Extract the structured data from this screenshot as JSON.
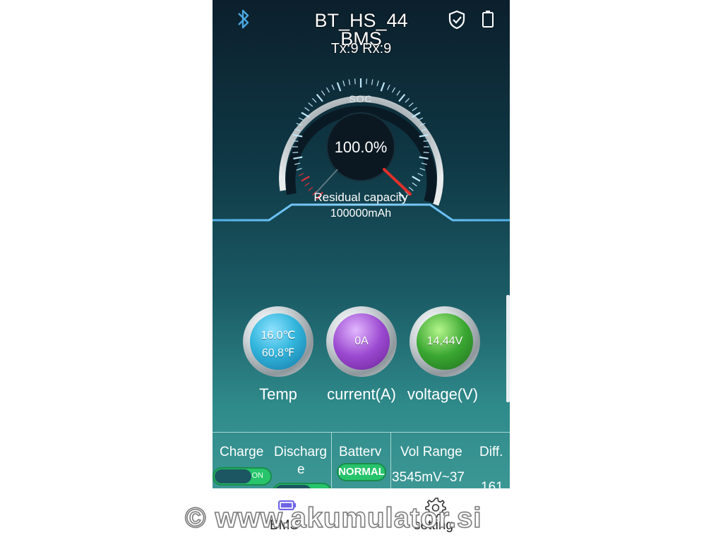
{
  "header": {
    "device_name": "BT_HS_44",
    "subtitle": "BMS",
    "tx_rx": "Tx:9 Rx:9"
  },
  "icons": {
    "bluetooth": "bluetooth-icon",
    "shield": "shield-check-icon",
    "battery": "battery-icon"
  },
  "gauge": {
    "label": "SOC",
    "value": "100.0%",
    "soc_percent": 100,
    "residual_label": "Residual capacity",
    "residual_value": "100000mAh"
  },
  "orbs": [
    {
      "line1": "16.0℃",
      "line2": "60,8℉",
      "label": "Temp",
      "color": "#33b6dc"
    },
    {
      "line1": "0A",
      "label": "current(A)",
      "color": "#9b49d0"
    },
    {
      "line1": "14,44V",
      "label": "voltage(V)",
      "color": "#3aa732"
    }
  ],
  "info": {
    "charge": {
      "header": "Charge",
      "state": "ON"
    },
    "discharge": {
      "header_line1": "Discharg",
      "header_line2": "e"
    },
    "battery": {
      "header": "Battery",
      "status": "NORMAL"
    },
    "vol_range": {
      "header": "Vol Range",
      "value": "3545mV~37"
    },
    "diff": {
      "header": "Diff.",
      "value": "161"
    }
  },
  "navbar": {
    "bms_label": "BMS",
    "setting_label": "setting"
  },
  "watermark": "© www.akumulator.si",
  "colors": {
    "accent_blue": "#4db6e8",
    "needle_red": "#e0302a",
    "toggle_green": "#27c46b"
  }
}
